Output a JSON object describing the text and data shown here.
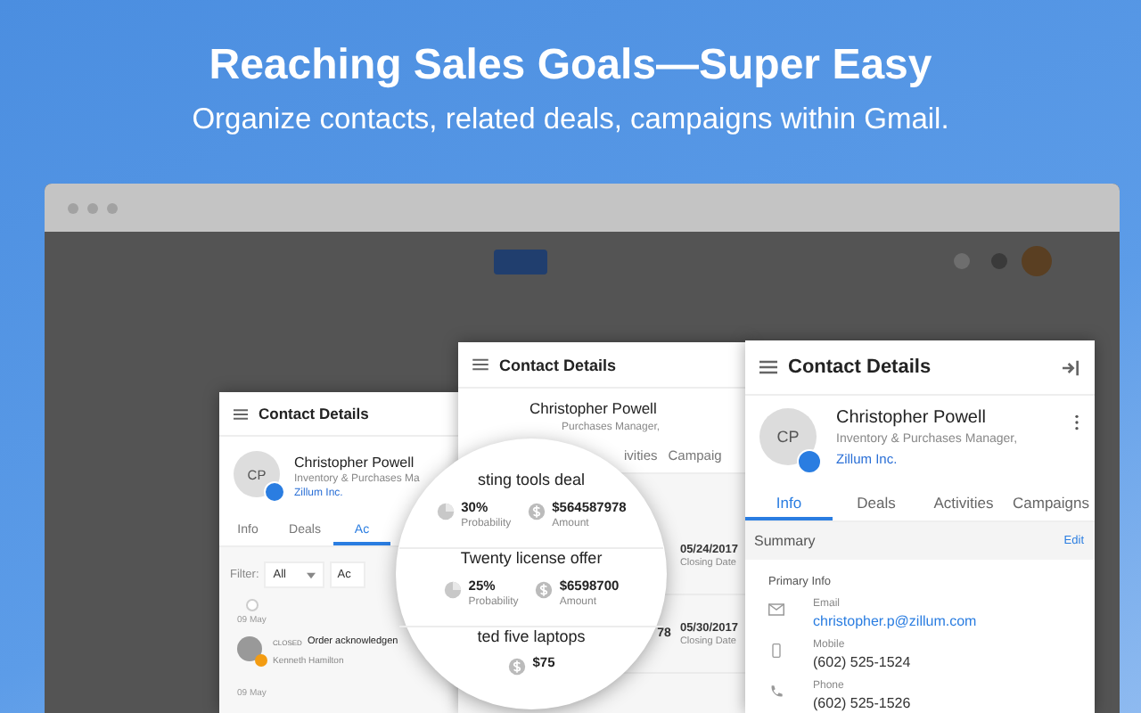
{
  "hero": {
    "title": "Reaching Sales Goals—Super Easy",
    "subtitle": "Organize contacts, related deals, campaigns within Gmail."
  },
  "left_panel": {
    "title": "Contact Details",
    "initials": "CP",
    "name": "Christopher Powell",
    "job": "Inventory & Purchases Ma",
    "company": "Zillum Inc.",
    "tabs": [
      {
        "label": "Info",
        "selected": false
      },
      {
        "label": "Deals",
        "selected": false
      },
      {
        "label": "Ac",
        "selected": true
      }
    ],
    "filter_label": "Filter:",
    "filter_value": "All",
    "second_filter": "Ac",
    "timeline": [
      {
        "date": "09 May",
        "status": "CLOSED",
        "title": "Order acknowledgen",
        "owner": "Kenneth Hamilton"
      }
    ],
    "last_date": "09 May"
  },
  "middle_panel": {
    "title": "Contact Details",
    "name": "Christopher Powell",
    "job": "Purchases Manager,",
    "tabs": [
      {
        "label": "ivities",
        "selected": false
      },
      {
        "label": "Campaig",
        "selected": false
      }
    ],
    "rows": [
      {
        "date": "05/24/2017",
        "date_label": "Closing Date"
      },
      {
        "amount": "78",
        "date": "05/30/2017",
        "date_label": "Closing Date"
      }
    ]
  },
  "magnifier": {
    "deals": [
      {
        "title": "sting tools deal",
        "probability": "30%",
        "probability_label": "Probability",
        "amount": "$564587978",
        "amount_label": "Amount"
      },
      {
        "title": "Twenty license offer",
        "probability": "25%",
        "probability_label": "Probability",
        "amount": "$6598700",
        "amount_label": "Amount"
      },
      {
        "title": "ted five laptops",
        "amount": "$75"
      }
    ]
  },
  "right_panel": {
    "title": "Contact Details",
    "initials": "CP",
    "name": "Christopher Powell",
    "job": "Inventory & Purchases Manager,",
    "company": "Zillum Inc.",
    "tabs": [
      {
        "label": "Info",
        "selected": true
      },
      {
        "label": "Deals",
        "selected": false
      },
      {
        "label": "Activities",
        "selected": false
      },
      {
        "label": "Campaigns",
        "selected": false
      }
    ],
    "summary": "Summary",
    "edit": "Edit",
    "section": "Primary Info",
    "fields": [
      {
        "kind": "email",
        "label": "Email",
        "value": "christopher.p@zillum.com"
      },
      {
        "kind": "mobile",
        "label": "Mobile",
        "value": "(602) 525-1524"
      },
      {
        "kind": "phone",
        "label": "Phone",
        "value": "(602) 525-1526"
      }
    ]
  }
}
